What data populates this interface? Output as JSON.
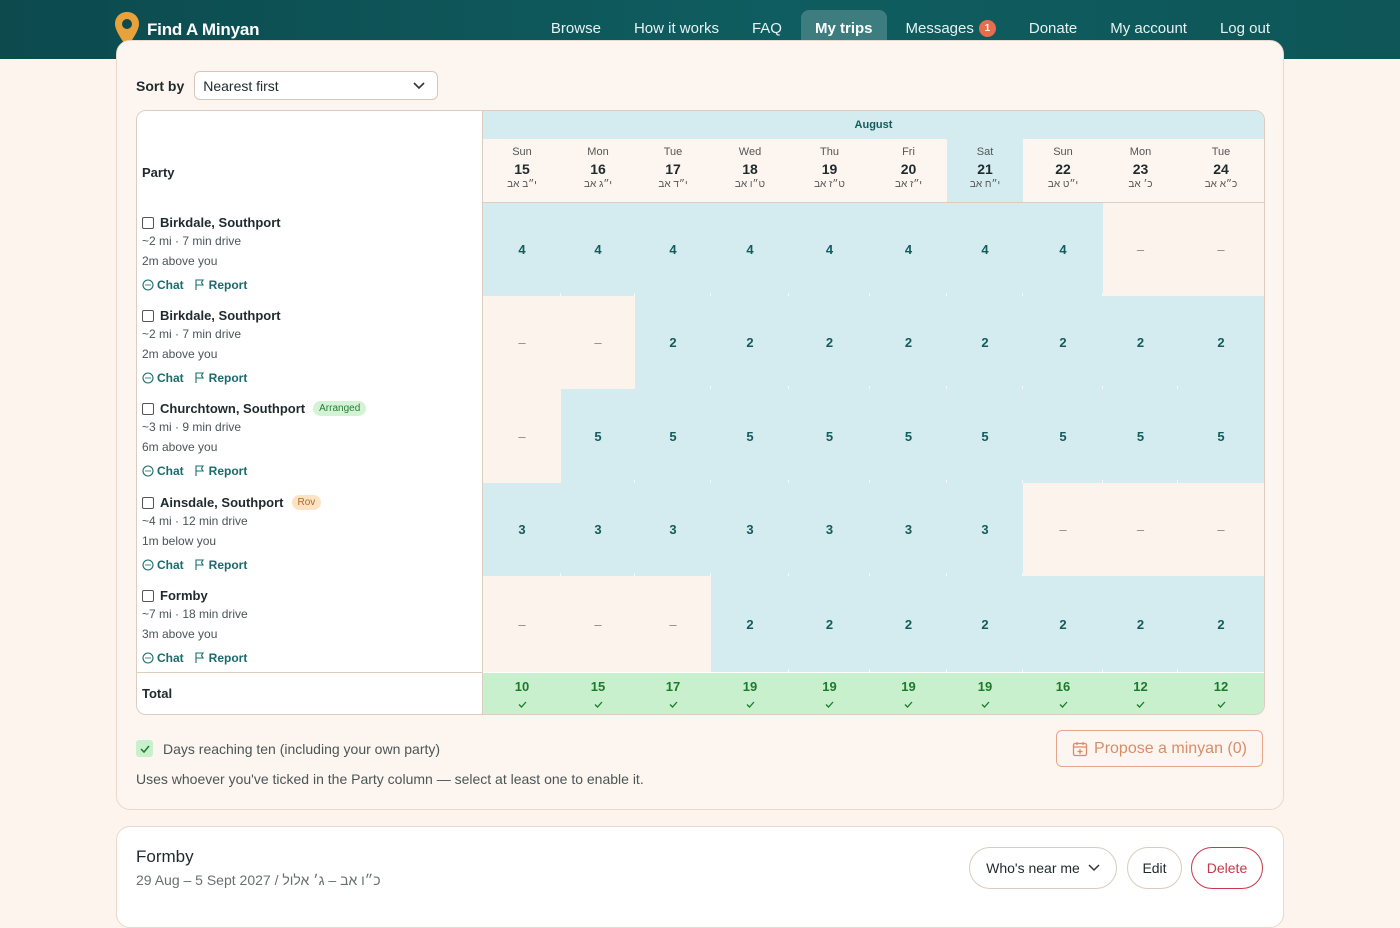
{
  "nav": {
    "brand": "Find A Minyan",
    "brand_icon": "map-pin-icon",
    "links": [
      {
        "label": "Browse",
        "active": false
      },
      {
        "label": "How it works",
        "active": false
      },
      {
        "label": "FAQ",
        "active": false
      },
      {
        "label": "My trips",
        "active": true
      },
      {
        "label": "Messages",
        "active": false,
        "badge": "1"
      },
      {
        "label": "Donate",
        "active": false
      },
      {
        "label": "My account",
        "active": false
      },
      {
        "label": "Log out",
        "active": false
      }
    ]
  },
  "sort": {
    "label": "Sort by",
    "value": "Nearest first"
  },
  "table": {
    "party_header": "Party",
    "month": "August",
    "days": [
      {
        "dow": "Sun",
        "num": "15",
        "heb": "י״ב אב"
      },
      {
        "dow": "Mon",
        "num": "16",
        "heb": "י״ג אב"
      },
      {
        "dow": "Tue",
        "num": "17",
        "heb": "י״ד אב"
      },
      {
        "dow": "Wed",
        "num": "18",
        "heb": "ט״ו אב"
      },
      {
        "dow": "Thu",
        "num": "19",
        "heb": "ט״ז אב"
      },
      {
        "dow": "Fri",
        "num": "20",
        "heb": "י״ז אב"
      },
      {
        "dow": "Sat",
        "num": "21",
        "heb": "י״ח אב"
      },
      {
        "dow": "Sun",
        "num": "22",
        "heb": "י״ט אב"
      },
      {
        "dow": "Mon",
        "num": "23",
        "heb": "כ׳ אב"
      },
      {
        "dow": "Tue",
        "num": "24",
        "heb": "כ״א אב"
      }
    ],
    "parties": [
      {
        "name": "Birkdale, Southport",
        "tag": "",
        "distance": "~2 mi · 7 min drive",
        "elevation": "2m above you",
        "chat": "Chat",
        "report": "Report",
        "cells": [
          "4",
          "4",
          "4",
          "4",
          "4",
          "4",
          "4",
          "4",
          "–",
          "–"
        ]
      },
      {
        "name": "Birkdale, Southport",
        "tag": "",
        "distance": "~2 mi · 7 min drive",
        "elevation": "2m above you",
        "chat": "Chat",
        "report": "Report",
        "cells": [
          "–",
          "–",
          "2",
          "2",
          "2",
          "2",
          "2",
          "2",
          "2",
          "2"
        ]
      },
      {
        "name": "Churchtown, Southport",
        "tag": "Arranged",
        "tag_color": "green",
        "distance": "~3 mi · 9 min drive",
        "elevation": "6m above you",
        "chat": "Chat",
        "report": "Report",
        "cells": [
          "–",
          "5",
          "5",
          "5",
          "5",
          "5",
          "5",
          "5",
          "5",
          "5"
        ]
      },
      {
        "name": "Ainsdale, Southport",
        "tag": "Rov",
        "tag_color": "orange",
        "distance": "~4 mi · 12 min drive",
        "elevation": "1m below you",
        "chat": "Chat",
        "report": "Report",
        "cells": [
          "3",
          "3",
          "3",
          "3",
          "3",
          "3",
          "3",
          "–",
          "–",
          "–"
        ]
      },
      {
        "name": "Formby",
        "tag": "",
        "distance": "~7 mi · 18 min drive",
        "elevation": "3m above you",
        "chat": "Chat",
        "report": "Report",
        "cells": [
          "–",
          "–",
          "–",
          "2",
          "2",
          "2",
          "2",
          "2",
          "2",
          "2"
        ]
      }
    ],
    "total_label": "Total",
    "totals": [
      "10",
      "15",
      "17",
      "19",
      "19",
      "19",
      "19",
      "16",
      "12",
      "12"
    ]
  },
  "legend": "Days reaching ten (including your own party)",
  "hint": "Uses whoever you've ticked in the Party column — select at least one to enable it.",
  "propose_button": "Propose a minyan (0)",
  "trip": {
    "title": "Formby",
    "dates": "29 Aug – 5 Sept 2027 / כ״ו אב – ג׳ אלול",
    "near_button": "Who's near me",
    "edit_button": "Edit",
    "delete_button": "Delete"
  },
  "colors": {
    "nav_bg": "#0f5d60",
    "brand_pin": "#e8a23c",
    "available_cell": "#d4ecef",
    "total_cell": "#c8f0cd",
    "accent_text": "#145b5c",
    "delete_red": "#c7384b",
    "propose_orange": "#d98c6a"
  }
}
